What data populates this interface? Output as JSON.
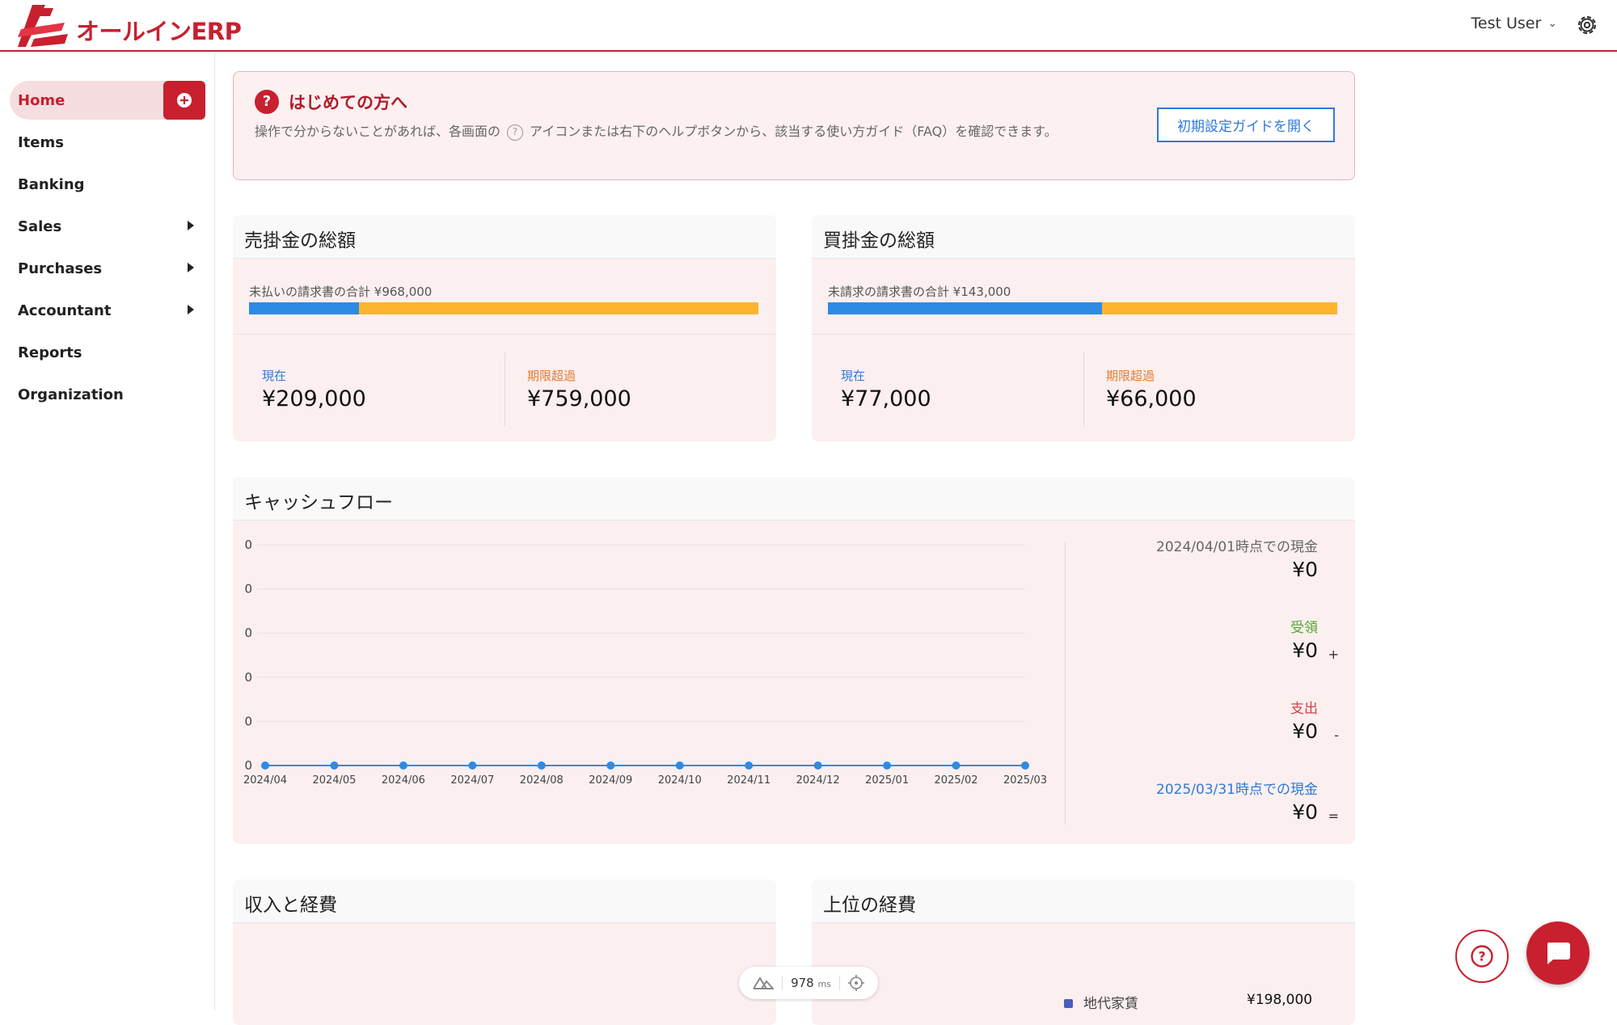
{
  "app": {
    "logo_text": "オールインERP",
    "user_name": "Test User"
  },
  "sidebar": {
    "items": [
      {
        "label": "Home"
      },
      {
        "label": "Items"
      },
      {
        "label": "Banking"
      },
      {
        "label": "Sales"
      },
      {
        "label": "Purchases"
      },
      {
        "label": "Accountant"
      },
      {
        "label": "Reports"
      },
      {
        "label": "Organization"
      }
    ]
  },
  "banner": {
    "title": "はじめての方へ",
    "desc_before": "操作で分からないことがあれば、各画面の",
    "desc_after": "アイコンまたは右下のヘルプボタンから、該当する使い方ガイド（FAQ）を確認できます。",
    "button": "初期設定ガイドを開く"
  },
  "receivables": {
    "title": "売掛金の総額",
    "subtitle": "未払いの請求書の合計 ¥968,000",
    "current_label": "現在",
    "current_value": "¥209,000",
    "overdue_label": "期限超過",
    "overdue_value": "¥759,000",
    "current_fraction": 0.216
  },
  "payables": {
    "title": "買掛金の総額",
    "subtitle": "未請求の請求書の合計 ¥143,000",
    "current_label": "現在",
    "current_value": "¥77,000",
    "overdue_label": "期限超過",
    "overdue_value": "¥66,000",
    "current_fraction": 0.538
  },
  "cashflow": {
    "title": "キャッシュフロー",
    "opening_label": "2024/04/01時点での現金",
    "opening_value": "¥0",
    "received_label": "受領",
    "received_value": "¥0",
    "received_op": "+",
    "spent_label": "支出",
    "spent_value": "¥0",
    "spent_op": "-",
    "closing_label": "2025/03/31時点での現金",
    "closing_value": "¥0",
    "closing_op": "="
  },
  "chart_data": {
    "type": "line",
    "categories": [
      "2024/04",
      "2024/05",
      "2024/06",
      "2024/07",
      "2024/08",
      "2024/09",
      "2024/10",
      "2024/11",
      "2024/12",
      "2025/01",
      "2025/02",
      "2025/03"
    ],
    "values": [
      0,
      0,
      0,
      0,
      0,
      0,
      0,
      0,
      0,
      0,
      0,
      0
    ],
    "y_tick_labels": [
      "0",
      "0",
      "0",
      "0",
      "0",
      "0"
    ],
    "line_color": "#2d8be6"
  },
  "income_expense": {
    "title": "収入と経費"
  },
  "top_expenses": {
    "title": "上位の経費",
    "items": [
      {
        "name": "地代家賃",
        "value": "¥198,000"
      }
    ]
  },
  "perf": {
    "value": "978",
    "unit": "ms"
  },
  "colors": {
    "brand": "#c8202f",
    "blue": "#2d8be6",
    "yellow": "#fdb52e"
  }
}
